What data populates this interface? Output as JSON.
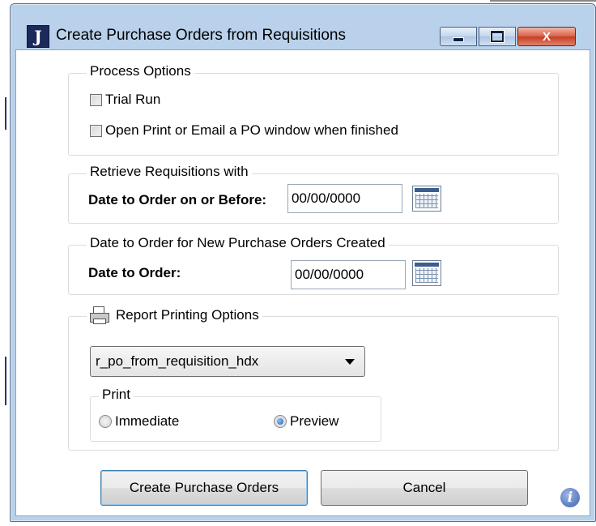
{
  "window": {
    "title": "Create Purchase Orders from Requisitions",
    "app_icon_letter": "J",
    "close_glyph": "X"
  },
  "process_options": {
    "legend": "Process Options",
    "trial_run_label": "Trial Run",
    "trial_run_checked": false,
    "open_print_label": "Open Print or Email a PO window when finished",
    "open_print_checked": false
  },
  "retrieve": {
    "legend": "Retrieve Requisitions with",
    "date_label": "Date to Order on or Before:",
    "date_value": "00/00/0000"
  },
  "date_to_order": {
    "legend": "Date to Order for New Purchase Orders Created",
    "date_label": "Date to Order:",
    "date_value": "00/00/0000"
  },
  "report": {
    "legend": "Report Printing Options",
    "selected_report": "r_po_from_requisition_hdx",
    "print_legend": "Print",
    "immediate_label": "Immediate",
    "preview_label": "Preview",
    "selected_print": "Preview"
  },
  "buttons": {
    "create": "Create Purchase Orders",
    "cancel": "Cancel"
  },
  "info_glyph": "i",
  "colors": {
    "frame": "#b9d1ea",
    "close_button": "#c73d22",
    "radio_dot": "#1b5fb8"
  }
}
